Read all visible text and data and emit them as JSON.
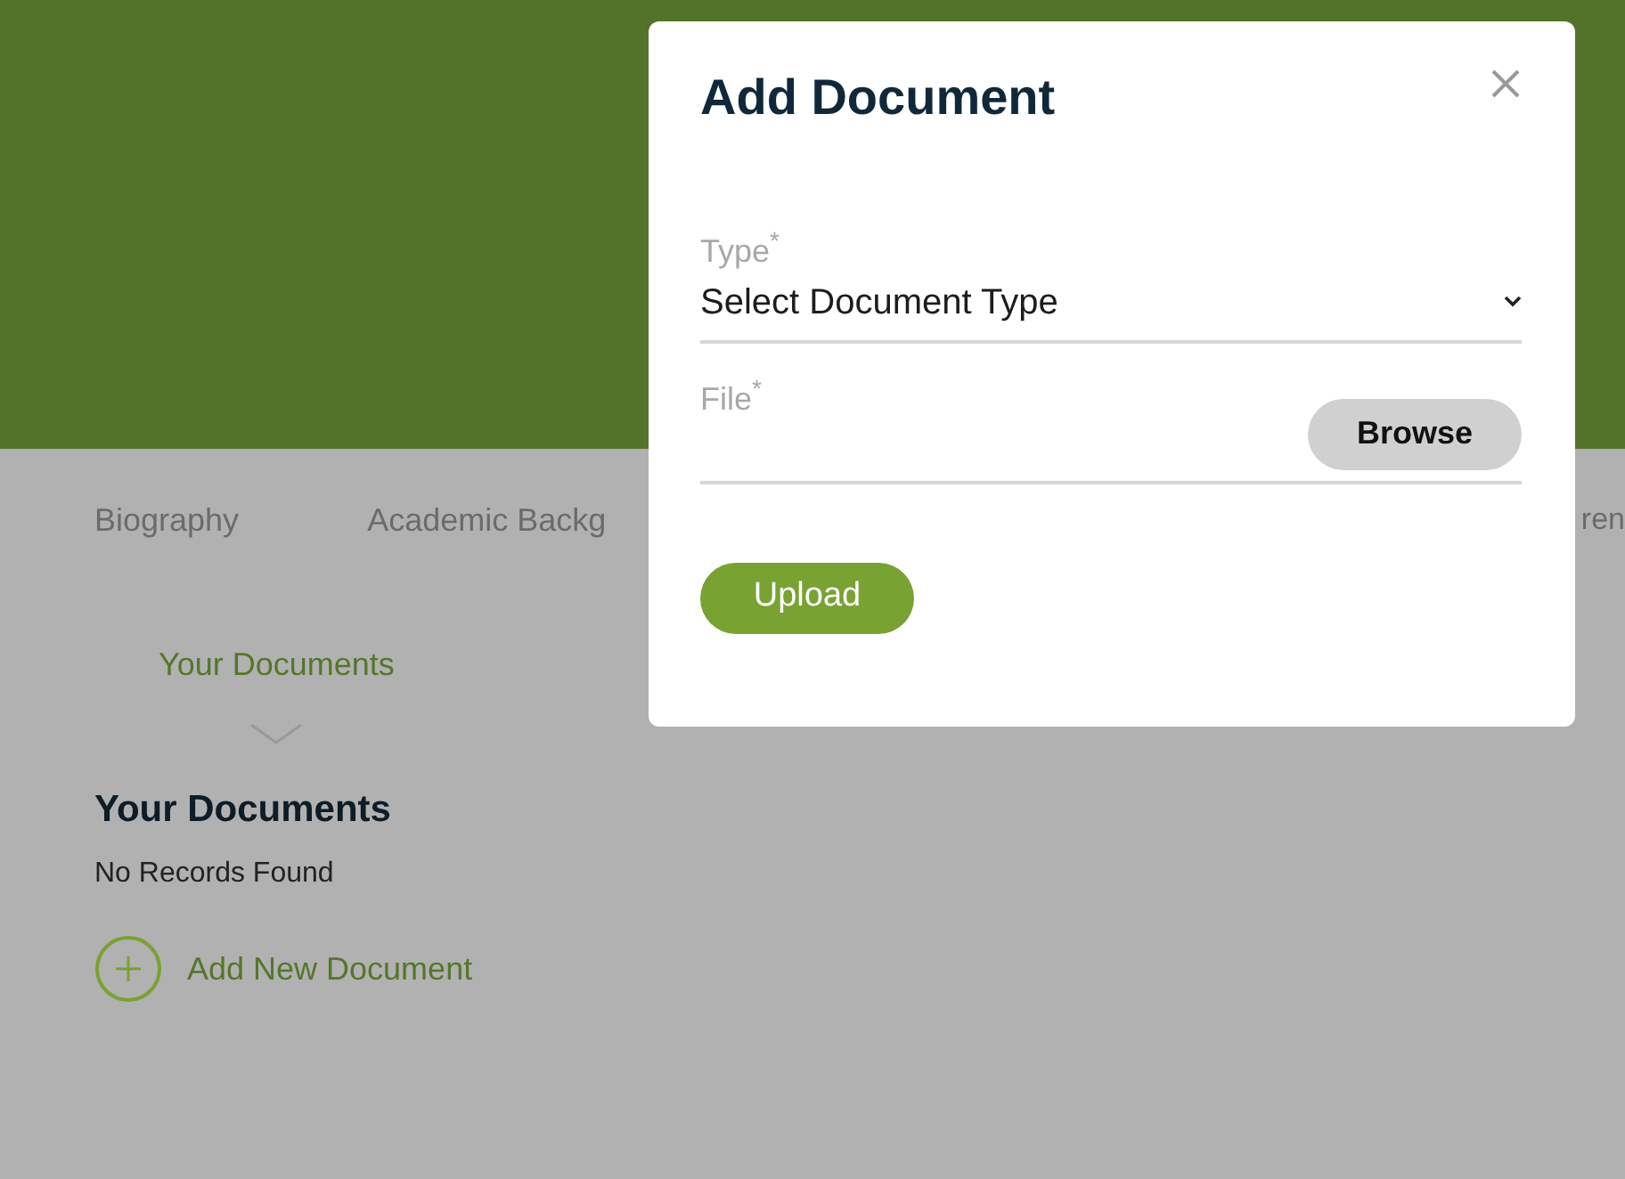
{
  "tabs": [
    {
      "label": "Biography",
      "selected": false
    },
    {
      "label": "Academic Backg",
      "selected": false
    },
    {
      "label": "ren",
      "selected": false
    }
  ],
  "subtabs": [
    {
      "label": "Your Documents",
      "selected": true
    }
  ],
  "section": {
    "title": "Your Documents",
    "empty_text": "No Records Found",
    "add_link": "Add New Document"
  },
  "modal": {
    "title": "Add Document",
    "fields": [
      {
        "kind": "select",
        "label": "Type$^{*}$",
        "value": "Select Document Type"
      },
      {
        "kind": "file",
        "label": "File$^{*}$",
        "button": "Browse"
      }
    ],
    "submit": "Upload"
  }
}
